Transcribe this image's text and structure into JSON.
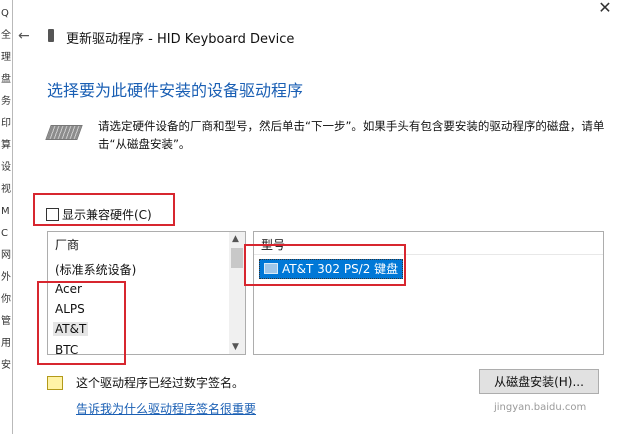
{
  "window": {
    "title": "更新驱动程序 - HID Keyboard Device",
    "close_glyph": "✕",
    "back_glyph": "←"
  },
  "left_strip": [
    "Q",
    "全",
    "理",
    "盘",
    "务",
    "印",
    "算",
    "设",
    "视",
    "M",
    "C",
    "网",
    "外",
    "你",
    "管",
    "用",
    "安"
  ],
  "heading": "选择要为此硬件安装的设备驱动程序",
  "description": "请选定硬件设备的厂商和型号，然后单击“下一步”。如果手头有包含要安装的驱动程序的磁盘，请单击“从磁盘安装”。",
  "show_compatible": {
    "label": "显示兼容硬件(C)",
    "checked": false
  },
  "manufacturers": {
    "header": "厂商",
    "items": [
      "(标准系统设备)",
      "Acer",
      "ALPS",
      "AT&T",
      "BTC"
    ],
    "selected": "AT&T"
  },
  "models": {
    "header": "型号",
    "items": [
      "AT&T 302 PS/2 键盘"
    ],
    "selected": "AT&T 302 PS/2 键盘"
  },
  "signature_note": "这个驱动程序已经过数字签名。",
  "signature_link": "告诉我为什么驱动程序签名很重要",
  "have_disk_button": "从磁盘安装(H)...",
  "watermark": "jingyan.baidu.com",
  "colors": {
    "heading": "#1a5fb4",
    "selection": "#0078d7",
    "annotation": "#d7262f"
  }
}
